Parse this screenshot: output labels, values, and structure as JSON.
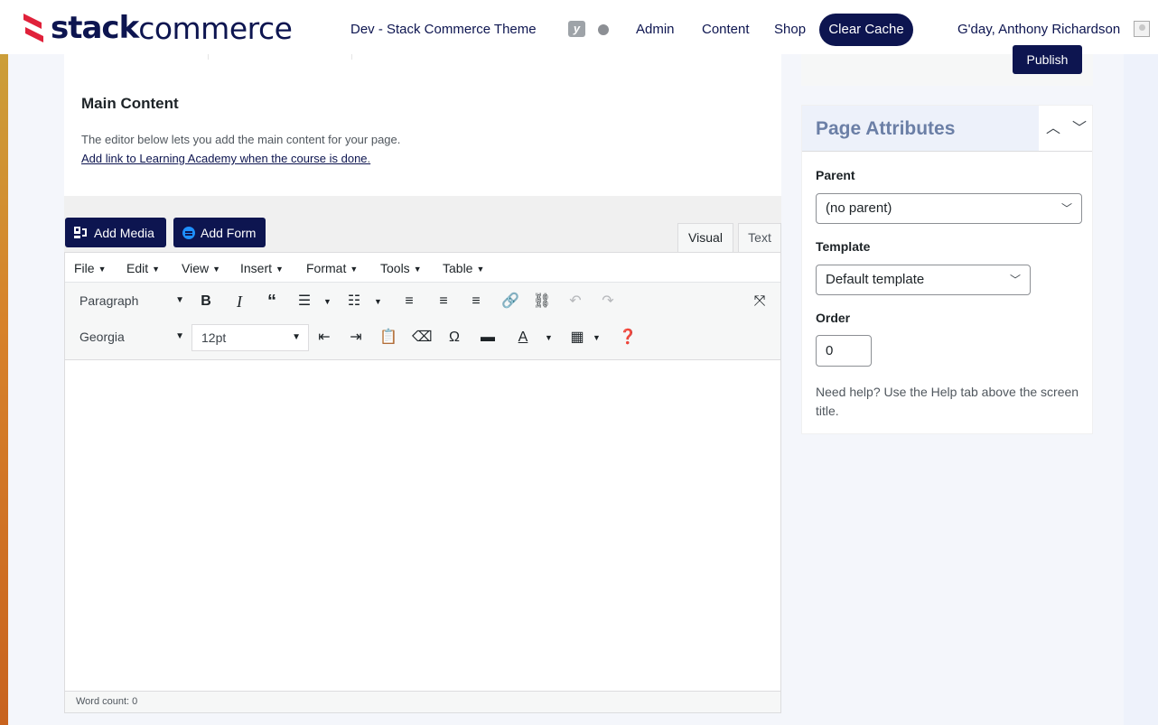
{
  "colors": {
    "brand_navy": "#0d1550",
    "brand_red": "#e0213a",
    "form_icon_blue": "#1e90ff",
    "panel_header": "#edf1fa"
  },
  "topbar": {
    "logo_bold": "stack",
    "logo_light": "commerce",
    "site_name": "Dev - Stack Commerce Theme",
    "yoast_icon": "yoast-icon",
    "status_dot": "status-dot-icon",
    "nav": [
      "Admin",
      "Content",
      "Shop"
    ],
    "clear_cache": "Clear Cache",
    "greeting": "G'day, Anthony Richardson"
  },
  "main_content": {
    "title": "Main Content",
    "description": "The editor below lets you add the main content for your page.",
    "link_text": "Add link to Learning Academy when the course is done",
    "link_suffix": "."
  },
  "editor": {
    "add_media": "Add Media",
    "add_form": "Add Form",
    "tabs": {
      "visual": "Visual",
      "text": "Text"
    },
    "menus": [
      "File",
      "Edit",
      "View",
      "Insert",
      "Format",
      "Tools",
      "Table"
    ],
    "format_select": "Paragraph",
    "font_select": "Georgia",
    "size_select": "12pt",
    "word_count": "Word count: 0"
  },
  "sidebar": {
    "publish": "Publish",
    "page_attributes": {
      "title": "Page Attributes",
      "parent_label": "Parent",
      "parent_value": "(no parent)",
      "template_label": "Template",
      "template_value": "Default template",
      "order_label": "Order",
      "order_value": "0",
      "help": "Need help? Use the Help tab above the screen title."
    }
  }
}
